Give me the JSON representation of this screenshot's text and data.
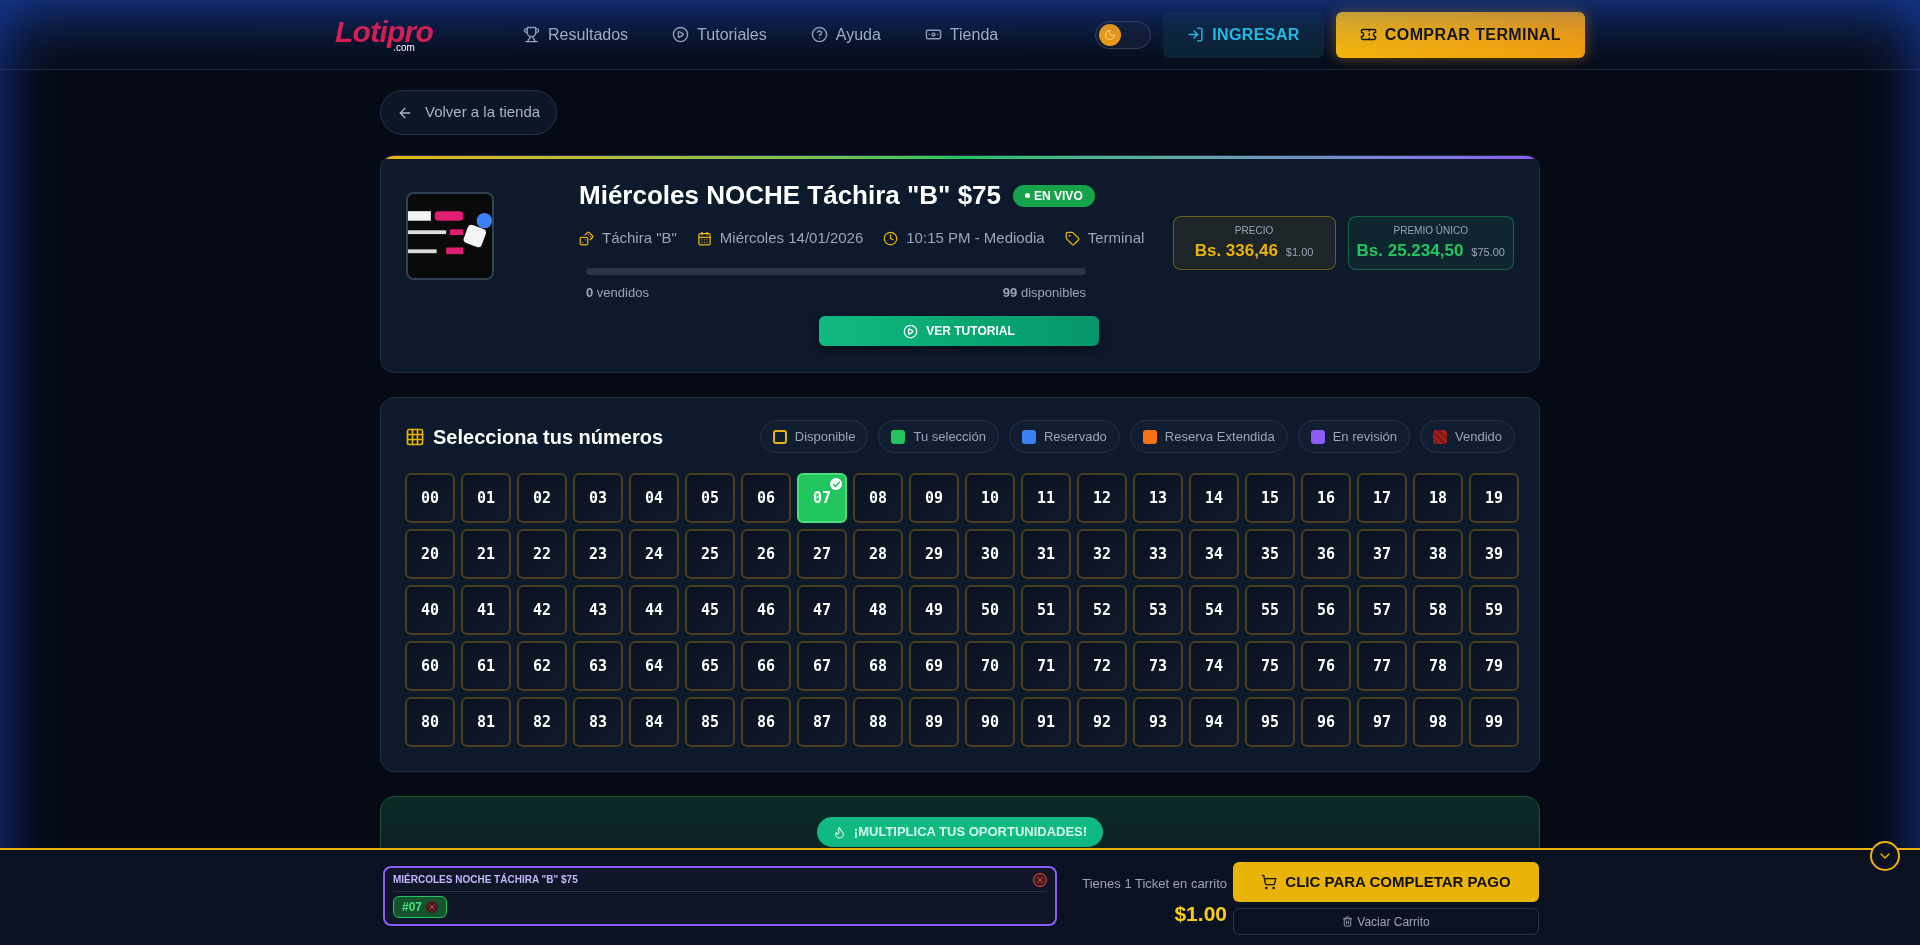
{
  "header": {
    "logo": "Lotipro",
    "logo_sub": ".com",
    "nav": [
      {
        "label": "Resultados"
      },
      {
        "label": "Tutoriales"
      },
      {
        "label": "Ayuda"
      },
      {
        "label": "Tienda"
      }
    ],
    "theme_toggle": {
      "on": false
    },
    "login": "INGRESAR",
    "buy": "COMPRAR TERMINAL"
  },
  "back": "Volver a la tienda",
  "draw": {
    "title": "Miércoles NOCHE Táchira \"B\" $75",
    "badge": "EN VIVO",
    "meta": [
      {
        "text": "Táchira \"B\""
      },
      {
        "text": "Miércoles 14/01/2026"
      },
      {
        "text": "10:15 PM - Mediodia"
      },
      {
        "text": "Terminal"
      }
    ],
    "level": 0,
    "sold_n": "0",
    "sold": "vendidos",
    "avail_n": "99",
    "avail": "disponibles",
    "tutorial": "VER TUTORIAL",
    "prices": [
      {
        "label": "PRECIO",
        "value": "Bs. 336,46",
        "usd": "$1.00",
        "color": "#eab308"
      },
      {
        "label": "PREMIO ÚNICO",
        "value": "Bs. 25.234,50",
        "usd": "$75.00",
        "color": "#22c55e"
      }
    ]
  },
  "numbers_title": "Selecciona tus números",
  "legend": [
    {
      "label": "Disponible",
      "kind": "outline",
      "color": "#eab308"
    },
    {
      "label": "Tu selección",
      "kind": "solid",
      "color": "#22c55e"
    },
    {
      "label": "Reservado",
      "kind": "solid",
      "color": "#3b82f6"
    },
    {
      "label": "Reserva Extendida",
      "kind": "solid",
      "color": "#f97316"
    },
    {
      "label": "En revisión",
      "kind": "solid",
      "color": "#8b5cf6"
    },
    {
      "label": "Vendido",
      "kind": "striped",
      "color": "#7f1d1d"
    }
  ],
  "numbers": [
    {
      "label": "00",
      "selected": false
    },
    {
      "label": "01",
      "selected": false
    },
    {
      "label": "02",
      "selected": false
    },
    {
      "label": "03",
      "selected": false
    },
    {
      "label": "04",
      "selected": false
    },
    {
      "label": "05",
      "selected": false
    },
    {
      "label": "06",
      "selected": false
    },
    {
      "label": "07",
      "selected": true
    },
    {
      "label": "08",
      "selected": false
    },
    {
      "label": "09",
      "selected": false
    },
    {
      "label": "10",
      "selected": false
    },
    {
      "label": "11",
      "selected": false
    },
    {
      "label": "12",
      "selected": false
    },
    {
      "label": "13",
      "selected": false
    },
    {
      "label": "14",
      "selected": false
    },
    {
      "label": "15",
      "selected": false
    },
    {
      "label": "16",
      "selected": false
    },
    {
      "label": "17",
      "selected": false
    },
    {
      "label": "18",
      "selected": false
    },
    {
      "label": "19",
      "selected": false
    },
    {
      "label": "20",
      "selected": false
    },
    {
      "label": "21",
      "selected": false
    },
    {
      "label": "22",
      "selected": false
    },
    {
      "label": "23",
      "selected": false
    },
    {
      "label": "24",
      "selected": false
    },
    {
      "label": "25",
      "selected": false
    },
    {
      "label": "26",
      "selected": false
    },
    {
      "label": "27",
      "selected": false
    },
    {
      "label": "28",
      "selected": false
    },
    {
      "label": "29",
      "selected": false
    },
    {
      "label": "30",
      "selected": false
    },
    {
      "label": "31",
      "selected": false
    },
    {
      "label": "32",
      "selected": false
    },
    {
      "label": "33",
      "selected": false
    },
    {
      "label": "34",
      "selected": false
    },
    {
      "label": "35",
      "selected": false
    },
    {
      "label": "36",
      "selected": false
    },
    {
      "label": "37",
      "selected": false
    },
    {
      "label": "38",
      "selected": false
    },
    {
      "label": "39",
      "selected": false
    },
    {
      "label": "40",
      "selected": false
    },
    {
      "label": "41",
      "selected": false
    },
    {
      "label": "42",
      "selected": false
    },
    {
      "label": "43",
      "selected": false
    },
    {
      "label": "44",
      "selected": false
    },
    {
      "label": "45",
      "selected": false
    },
    {
      "label": "46",
      "selected": false
    },
    {
      "label": "47",
      "selected": false
    },
    {
      "label": "48",
      "selected": false
    },
    {
      "label": "49",
      "selected": false
    },
    {
      "label": "50",
      "selected": false
    },
    {
      "label": "51",
      "selected": false
    },
    {
      "label": "52",
      "selected": false
    },
    {
      "label": "53",
      "selected": false
    },
    {
      "label": "54",
      "selected": false
    },
    {
      "label": "55",
      "selected": false
    },
    {
      "label": "56",
      "selected": false
    },
    {
      "label": "57",
      "selected": false
    },
    {
      "label": "58",
      "selected": false
    },
    {
      "label": "59",
      "selected": false
    },
    {
      "label": "60",
      "selected": false
    },
    {
      "label": "61",
      "selected": false
    },
    {
      "label": "62",
      "selected": false
    },
    {
      "label": "63",
      "selected": false
    },
    {
      "label": "64",
      "selected": false
    },
    {
      "label": "65",
      "selected": false
    },
    {
      "label": "66",
      "selected": false
    },
    {
      "label": "67",
      "selected": false
    },
    {
      "label": "68",
      "selected": false
    },
    {
      "label": "69",
      "selected": false
    },
    {
      "label": "70",
      "selected": false
    },
    {
      "label": "71",
      "selected": false
    },
    {
      "label": "72",
      "selected": false
    },
    {
      "label": "73",
      "selected": false
    },
    {
      "label": "74",
      "selected": false
    },
    {
      "label": "75",
      "selected": false
    },
    {
      "label": "76",
      "selected": false
    },
    {
      "label": "77",
      "selected": false
    },
    {
      "label": "78",
      "selected": false
    },
    {
      "label": "79",
      "selected": false
    },
    {
      "label": "80",
      "selected": false
    },
    {
      "label": "81",
      "selected": false
    },
    {
      "label": "82",
      "selected": false
    },
    {
      "label": "83",
      "selected": false
    },
    {
      "label": "84",
      "selected": false
    },
    {
      "label": "85",
      "selected": false
    },
    {
      "label": "86",
      "selected": false
    },
    {
      "label": "87",
      "selected": false
    },
    {
      "label": "88",
      "selected": false
    },
    {
      "label": "89",
      "selected": false
    },
    {
      "label": "90",
      "selected": false
    },
    {
      "label": "91",
      "selected": false
    },
    {
      "label": "92",
      "selected": false
    },
    {
      "label": "93",
      "selected": false
    },
    {
      "label": "94",
      "selected": false
    },
    {
      "label": "95",
      "selected": false
    },
    {
      "label": "96",
      "selected": false
    },
    {
      "label": "97",
      "selected": false
    },
    {
      "label": "98",
      "selected": false
    },
    {
      "label": "99",
      "selected": false
    }
  ],
  "multiply": "¡MULTIPLICA TUS OPORTUNIDADES!",
  "cart": {
    "draw_title": "MIÉRCOLES NOCHE TÁCHIRA \"B\" $75",
    "chips": [
      "#07"
    ],
    "count_text": "Tienes 1 Ticket en carrito",
    "total": "$1.00",
    "pay": "CLIC PARA COMPLETAR PAGO",
    "clear": "Vaciar Carrito"
  }
}
